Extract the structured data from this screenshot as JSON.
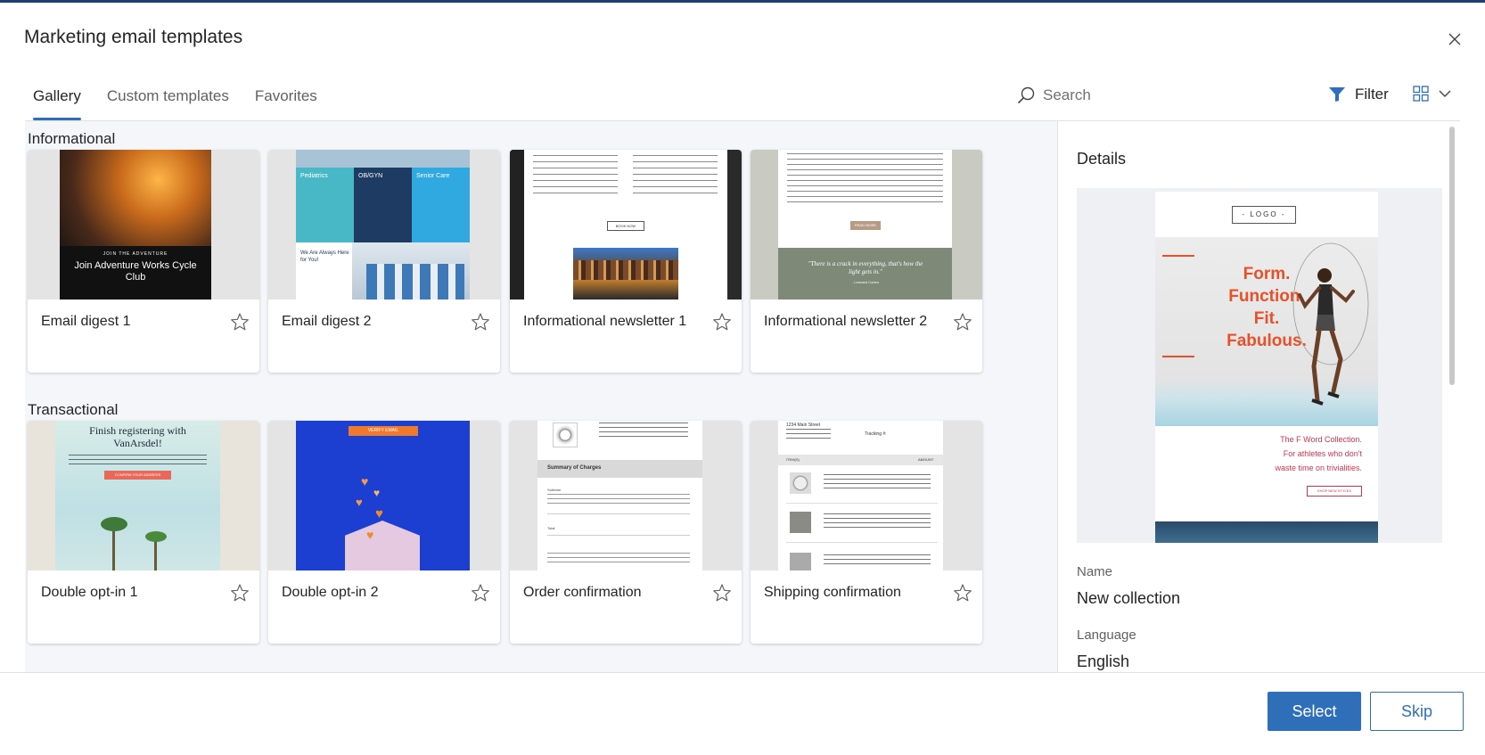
{
  "dialog": {
    "title": "Marketing email templates"
  },
  "tabs": [
    {
      "label": "Gallery",
      "active": true
    },
    {
      "label": "Custom templates",
      "active": false
    },
    {
      "label": "Favorites",
      "active": false
    }
  ],
  "search": {
    "placeholder": "Search",
    "icon": "search-icon"
  },
  "filter": {
    "label": "Filter",
    "icon": "filter-icon"
  },
  "view": {
    "icon": "grid-view-icon",
    "chevron": "chevron-down-icon"
  },
  "sections": [
    {
      "label": "Informational",
      "templates": [
        {
          "name": "Email digest 1",
          "thumb_text": [
            "JOIN THE ADVENTURE",
            "Join Adventure Works Cycle Club"
          ]
        },
        {
          "name": "Email digest 2",
          "thumb_text": [
            "Pediatrics",
            "OB/GYN",
            "Senior Care",
            "We Are Always Here for You!"
          ]
        },
        {
          "name": "Informational newsletter 1",
          "thumb_text": [
            "BOOK NOW"
          ]
        },
        {
          "name": "Informational newsletter 2",
          "thumb_text": [
            "READ MORE",
            "\"There is a crack in everything, that's how the light gets in.\"",
            "- Leonard Cohen"
          ]
        }
      ]
    },
    {
      "label": "Transactional",
      "templates": [
        {
          "name": "Double opt-in 1",
          "thumb_text": [
            "Finish registering with VanArsdel!",
            "CONFIRM YOUR ADDRESS"
          ]
        },
        {
          "name": "Double opt-in 2",
          "thumb_text": [
            "VERIFY EMAIL"
          ]
        },
        {
          "name": "Order confirmation",
          "thumb_text": [
            "Summary of Charges",
            "Subtotal",
            "Total"
          ]
        },
        {
          "name": "Shipping confirmation",
          "thumb_text": [
            "1234 Main Street",
            "Tracking #:",
            "ITEM(S)",
            "AMOUNT"
          ]
        }
      ]
    }
  ],
  "details": {
    "title": "Details",
    "preview": {
      "logo": "- LOGO -",
      "headline": [
        "Form.",
        "Function.",
        "Fit.",
        "Fabulous."
      ],
      "tagline": [
        "The F Word Collection.",
        "For athletes who don't",
        "waste time on trivialities."
      ],
      "cta": "SHOP NEW STYLES"
    },
    "fields": [
      {
        "label": "Name",
        "value": "New collection"
      },
      {
        "label": "Language",
        "value": "English"
      }
    ]
  },
  "footer": {
    "select_label": "Select",
    "skip_label": "Skip"
  },
  "colors": {
    "accent": "#2f6fba",
    "gallery_bg": "#f4f6f9",
    "brand_orange": "#e8502a"
  }
}
